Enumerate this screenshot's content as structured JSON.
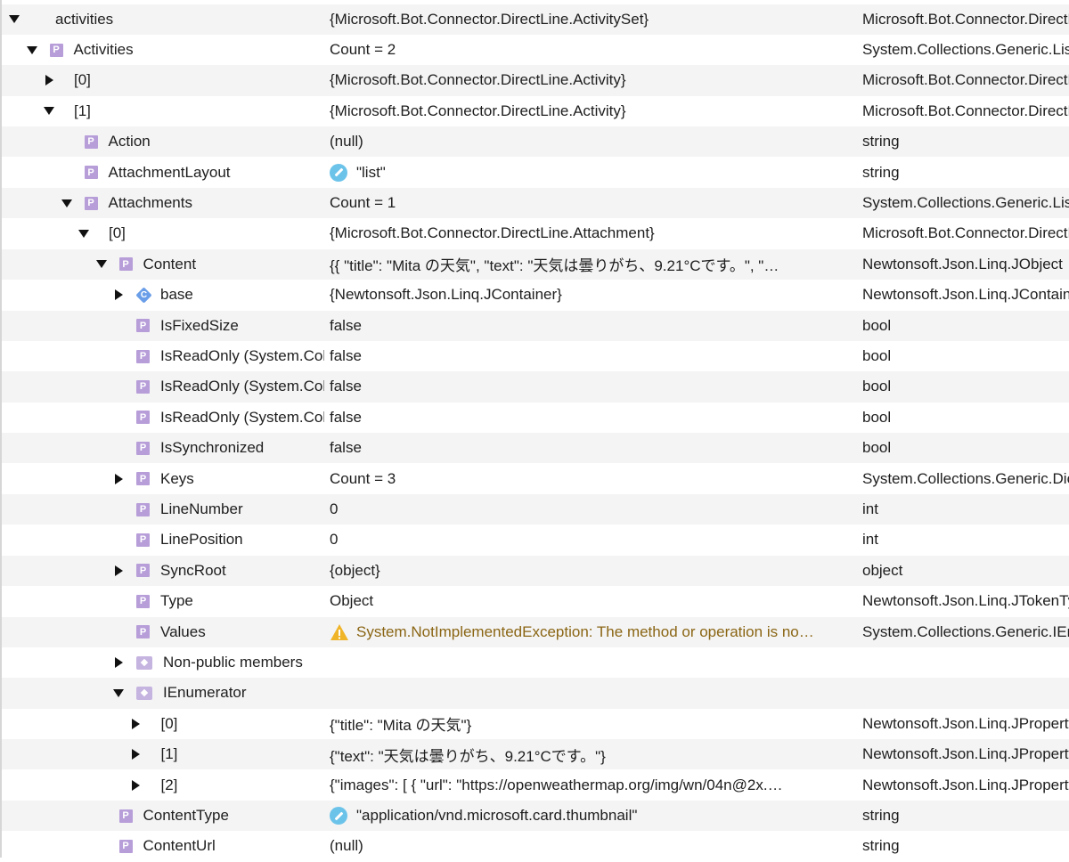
{
  "rows": [
    {
      "name": "activities",
      "value": "{Microsoft.Bot.Connector.DirectLine.ActivitySet}",
      "type": "Microsoft.Bot.Connector.DirectLine.ActivitySet",
      "indent": 0,
      "toggle": "expanded",
      "icon": "none",
      "value_icon": "none"
    },
    {
      "name": "Activities",
      "value": "Count = 2",
      "type": "System.Collections.Generic.List",
      "indent": 1,
      "toggle": "expanded",
      "icon": "property",
      "value_icon": "none"
    },
    {
      "name": "[0]",
      "value": "{Microsoft.Bot.Connector.DirectLine.Activity}",
      "type": "Microsoft.Bot.Connector.DirectLine.Activity",
      "indent": 2,
      "toggle": "collapsed",
      "icon": "none",
      "value_icon": "none"
    },
    {
      "name": "[1]",
      "value": "{Microsoft.Bot.Connector.DirectLine.Activity}",
      "type": "Microsoft.Bot.Connector.DirectLine.Activity",
      "indent": 2,
      "toggle": "expanded",
      "icon": "none",
      "value_icon": "none"
    },
    {
      "name": "Action",
      "value": "(null)",
      "type": "string",
      "indent": 3,
      "toggle": "none",
      "icon": "property",
      "value_icon": "none"
    },
    {
      "name": "AttachmentLayout",
      "value": "\"list\"",
      "type": "string",
      "indent": 3,
      "toggle": "none",
      "icon": "property",
      "value_icon": "pencil"
    },
    {
      "name": "Attachments",
      "value": "Count = 1",
      "type": "System.Collections.Generic.List",
      "indent": 3,
      "toggle": "expanded",
      "icon": "property",
      "value_icon": "none"
    },
    {
      "name": "[0]",
      "value": "{Microsoft.Bot.Connector.DirectLine.Attachment}",
      "type": "Microsoft.Bot.Connector.DirectLine.Attachment",
      "indent": 4,
      "toggle": "expanded",
      "icon": "none",
      "value_icon": "none"
    },
    {
      "name": "Content",
      "value": "{{   \"title\": \"Mita の天気\",   \"text\": \"天気は曇りがち、9.21°Cです。\",   \"…",
      "type": "Newtonsoft.Json.Linq.JObject",
      "indent": 5,
      "toggle": "expanded",
      "icon": "property",
      "value_icon": "none"
    },
    {
      "name": "base",
      "value": "{Newtonsoft.Json.Linq.JContainer}",
      "type": "Newtonsoft.Json.Linq.JContainer",
      "indent": 6,
      "toggle": "collapsed",
      "icon": "class",
      "value_icon": "none"
    },
    {
      "name": "IsFixedSize",
      "value": "false",
      "type": "bool",
      "indent": 6,
      "toggle": "none",
      "icon": "property",
      "value_icon": "none"
    },
    {
      "name": "IsReadOnly (System.Collections.IList)",
      "value": "false",
      "type": "bool",
      "indent": 6,
      "toggle": "none",
      "icon": "property",
      "value_icon": "none"
    },
    {
      "name": "IsReadOnly (System.Collections.Generic.ICollection)",
      "value": "false",
      "type": "bool",
      "indent": 6,
      "toggle": "none",
      "icon": "property",
      "value_icon": "none"
    },
    {
      "name": "IsReadOnly (System.Collections.Generic.IDictionary)",
      "value": "false",
      "type": "bool",
      "indent": 6,
      "toggle": "none",
      "icon": "property",
      "value_icon": "none"
    },
    {
      "name": "IsSynchronized",
      "value": "false",
      "type": "bool",
      "indent": 6,
      "toggle": "none",
      "icon": "property",
      "value_icon": "none"
    },
    {
      "name": "Keys",
      "value": "Count = 3",
      "type": "System.Collections.Generic.Dictionary",
      "indent": 6,
      "toggle": "collapsed",
      "icon": "property",
      "value_icon": "none"
    },
    {
      "name": "LineNumber",
      "value": "0",
      "type": "int",
      "indent": 6,
      "toggle": "none",
      "icon": "property",
      "value_icon": "none"
    },
    {
      "name": "LinePosition",
      "value": "0",
      "type": "int",
      "indent": 6,
      "toggle": "none",
      "icon": "property",
      "value_icon": "none"
    },
    {
      "name": "SyncRoot",
      "value": "{object}",
      "type": "object",
      "indent": 6,
      "toggle": "collapsed",
      "icon": "property",
      "value_icon": "none"
    },
    {
      "name": "Type",
      "value": "Object",
      "type": "Newtonsoft.Json.Linq.JTokenType",
      "indent": 6,
      "toggle": "none",
      "icon": "property",
      "value_icon": "none"
    },
    {
      "name": "Values",
      "value": "System.NotImplementedException: The method or operation is no…",
      "type": "System.Collections.Generic.IEnumerable",
      "indent": 6,
      "toggle": "none",
      "icon": "property",
      "value_icon": "warning"
    },
    {
      "name": "Non-public members",
      "value": "",
      "type": "",
      "indent": 6,
      "toggle": "collapsed",
      "icon": "nonpublic",
      "value_icon": "none"
    },
    {
      "name": "IEnumerator",
      "value": "",
      "type": "",
      "indent": 6,
      "toggle": "expanded",
      "icon": "nonpublic",
      "value_icon": "none"
    },
    {
      "name": "[0]",
      "value": "{\"title\": \"Mita の天気\"}",
      "type": "Newtonsoft.Json.Linq.JProperty",
      "indent": 7,
      "toggle": "collapsed",
      "icon": "none",
      "value_icon": "none"
    },
    {
      "name": "[1]",
      "value": "{\"text\": \"天気は曇りがち、9.21°Cです。\"}",
      "type": "Newtonsoft.Json.Linq.JProperty",
      "indent": 7,
      "toggle": "collapsed",
      "icon": "none",
      "value_icon": "none"
    },
    {
      "name": "[2]",
      "value": "{\"images\": [   {     \"url\": \"https://openweathermap.org/img/wn/04n@2x.…",
      "type": "Newtonsoft.Json.Linq.JProperty",
      "indent": 7,
      "toggle": "collapsed",
      "icon": "none",
      "value_icon": "none"
    },
    {
      "name": "ContentType",
      "value": "\"application/vnd.microsoft.card.thumbnail\"",
      "type": "string",
      "indent": 5,
      "toggle": "none",
      "icon": "property",
      "value_icon": "pencil"
    },
    {
      "name": "ContentUrl",
      "value": "(null)",
      "type": "string",
      "indent": 5,
      "toggle": "none",
      "icon": "property",
      "value_icon": "none"
    }
  ],
  "colors": {
    "row_alt": "#f4f4f4",
    "property_icon": "#b79ed9",
    "class_icon": "#6a9ee8",
    "pencil_icon": "#6cc3ea",
    "warning_icon": "#f0b429",
    "warning_text": "#8a6514"
  }
}
